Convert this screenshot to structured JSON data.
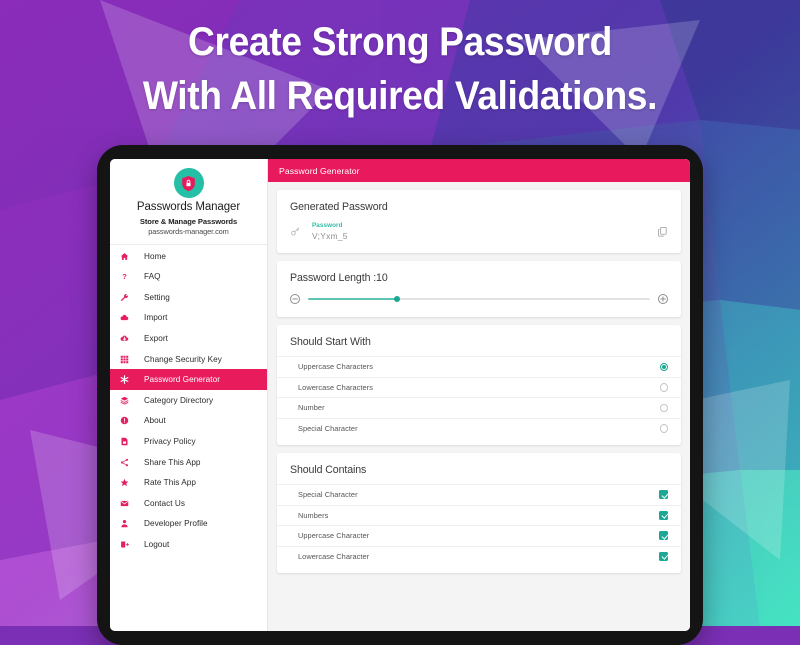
{
  "headline": {
    "line1": "Create Strong Password",
    "line2": "With All Required Validations."
  },
  "colors": {
    "accent_pink": "#e8195c",
    "accent_teal": "#1fa795",
    "logo_ring": "#25bfa5",
    "bg_top_left": "#8a2bb8",
    "bg_top_right": "#22418e",
    "bg_bottom_left": "#f262f0",
    "bg_bottom_right": "#45e3c2"
  },
  "sidebar": {
    "brand": {
      "logo_icon": "shield-lock-icon",
      "title": "Passwords Manager",
      "subtitle": "Store & Manage Passwords",
      "url": "passwords-manager.com"
    },
    "items": [
      {
        "label": "Home",
        "icon": "home-icon",
        "active": false
      },
      {
        "label": "FAQ",
        "icon": "question-mark-icon",
        "active": false
      },
      {
        "label": "Setting",
        "icon": "wrench-icon",
        "active": false
      },
      {
        "label": "Import",
        "icon": "cloud-upload-icon",
        "active": false
      },
      {
        "label": "Export",
        "icon": "cloud-download-icon",
        "active": false
      },
      {
        "label": "Change Security Key",
        "icon": "grid-keypad-icon",
        "active": false
      },
      {
        "label": "Password Generator",
        "icon": "asterisk-icon",
        "active": true
      },
      {
        "label": "Category Directory",
        "icon": "layers-icon",
        "active": false
      },
      {
        "label": "About",
        "icon": "info-icon",
        "active": false
      },
      {
        "label": "Privacy Policy",
        "icon": "document-lock-icon",
        "active": false
      },
      {
        "label": "Share This App",
        "icon": "share-icon",
        "active": false
      },
      {
        "label": "Rate This App",
        "icon": "star-icon",
        "active": false
      },
      {
        "label": "Contact Us",
        "icon": "envelope-icon",
        "active": false
      },
      {
        "label": "Developer Profile",
        "icon": "person-icon",
        "active": false
      },
      {
        "label": "Logout",
        "icon": "logout-icon",
        "active": false
      }
    ]
  },
  "main": {
    "topbar_title": "Password Generator",
    "generated_password": {
      "card_title": "Generated Password",
      "key_icon": "key-icon",
      "field_label": "Password",
      "value": "V;Yxm_5",
      "copy_icon": "copy-icon"
    },
    "password_length": {
      "card_title": "Password Length :10",
      "value": 10,
      "min": 1,
      "max": 38,
      "decrease_icon": "minus-circle-icon",
      "increase_icon": "plus-circle-icon"
    },
    "should_start_with": {
      "card_title": "Should Start With",
      "options": [
        {
          "label": "Uppercase Characters",
          "selected": true
        },
        {
          "label": "Lowercase Characters",
          "selected": false
        },
        {
          "label": "Number",
          "selected": false
        },
        {
          "label": "Special Character",
          "selected": false
        }
      ]
    },
    "should_contains": {
      "card_title": "Should Contains",
      "options": [
        {
          "label": "Special Character",
          "checked": true
        },
        {
          "label": "Numbers",
          "checked": true
        },
        {
          "label": "Uppercase Character",
          "checked": true
        },
        {
          "label": "Lowercase Character",
          "checked": true
        }
      ]
    }
  }
}
